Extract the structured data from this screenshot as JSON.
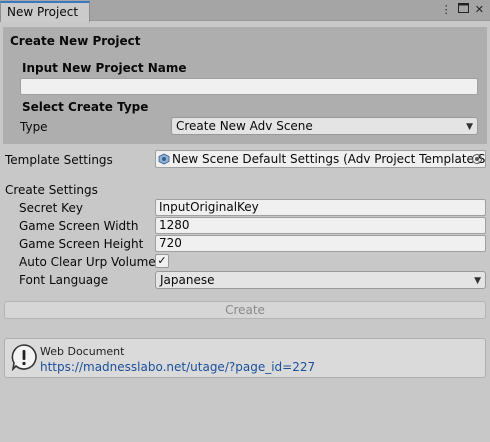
{
  "window": {
    "tab_title": "New Project",
    "menu_icon": "kebab-menu-icon",
    "maximize_icon": "maximize-icon",
    "close_icon": "close-icon"
  },
  "create_section": {
    "heading": "Create New Project",
    "name_label": "Input New Project Name",
    "name_value": "",
    "type_heading": "Select Create Type",
    "type_label": "Type",
    "type_value": "Create New Adv Scene"
  },
  "template": {
    "label": "Template Settings",
    "value": "New Scene Default Settings (Adv Project Template S"
  },
  "settings": {
    "heading": "Create Settings",
    "secret_key_label": "Secret Key",
    "secret_key_value": "InputOriginalKey",
    "width_label": "Game Screen Width",
    "width_value": "1280",
    "height_label": "Game Screen Height",
    "height_value": "720",
    "auto_clear_label": "Auto Clear Urp Volumes",
    "auto_clear_checked": true,
    "font_language_label": "Font Language",
    "font_language_value": "Japanese"
  },
  "create_button": "Create",
  "help": {
    "title": "Web Document",
    "link": "https://madnesslabo.net/utage/?page_id=227",
    "icon": "info-exclamation-icon"
  },
  "colors": {
    "background": "#c8c8c8",
    "panel": "#aeaeae",
    "tab_accent": "#3a79bb",
    "link": "#1b4f9c"
  }
}
